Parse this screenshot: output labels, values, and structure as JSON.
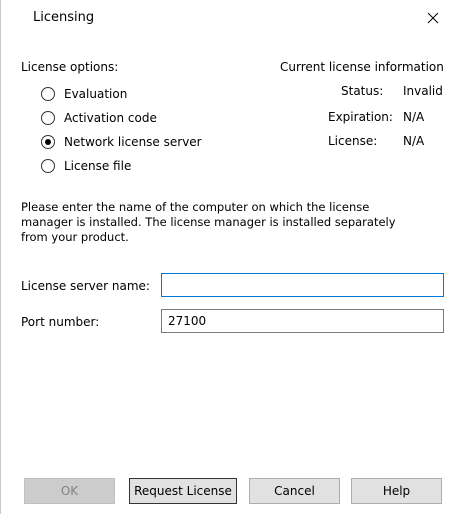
{
  "window": {
    "title": "Licensing"
  },
  "license_options": {
    "label": "License options:",
    "options": [
      {
        "label": "Evaluation",
        "checked": false
      },
      {
        "label": "Activation code",
        "checked": false
      },
      {
        "label": "Network license server",
        "checked": true
      },
      {
        "label": "License file",
        "checked": false
      }
    ]
  },
  "current_license": {
    "heading": "Current license information",
    "status_label": "Status:",
    "status_value": "Invalid",
    "expiration_label": "Expiration:",
    "expiration_value": "N/A",
    "license_label": "License:",
    "license_value": "N/A"
  },
  "instructions": {
    "line1": "Please enter the name of the computer on which the license",
    "line2": "manager is installed. The license manager is installed separately",
    "line3": "from your product."
  },
  "fields": {
    "server_label": "License server name:",
    "server_value": "",
    "port_label": "Port number:",
    "port_value": "27100"
  },
  "buttons": {
    "ok": "OK",
    "request_license": "Request License",
    "cancel": "Cancel",
    "help": "Help"
  }
}
